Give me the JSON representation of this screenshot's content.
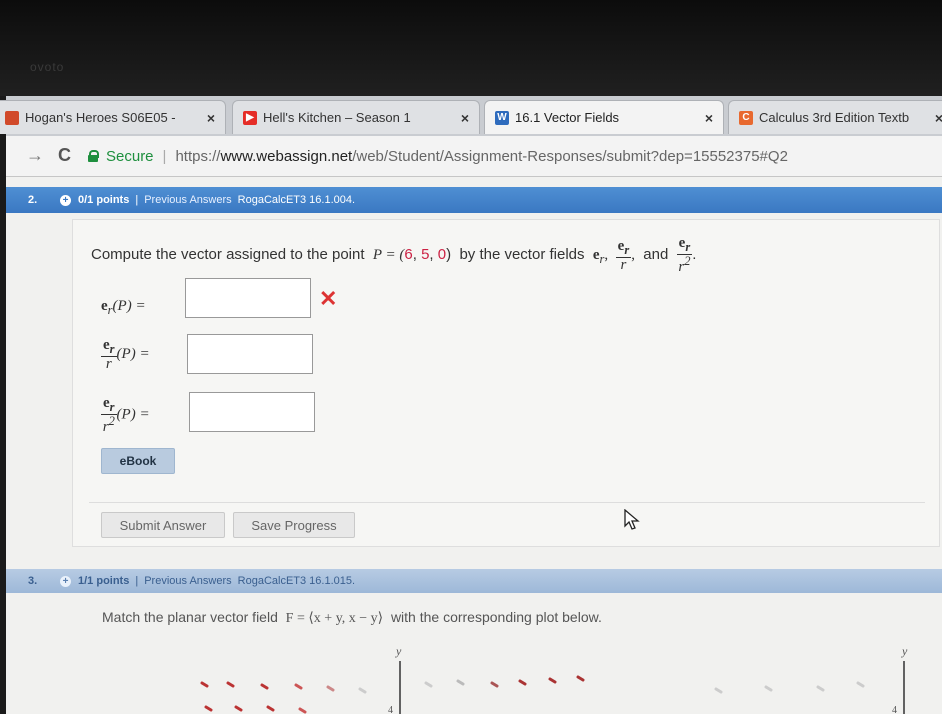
{
  "bezel": {
    "brand": "ovoto"
  },
  "tabs": [
    {
      "title": "Hogan's Heroes S06E05 -",
      "favicon_color": "#d14a2a",
      "favicon_glyph": ""
    },
    {
      "title": "Hell's Kitchen – Season 1",
      "favicon_color": "#e52d27",
      "favicon_glyph": "▶"
    },
    {
      "title": "16.1 Vector Fields",
      "favicon_color": "#2e6bbd",
      "favicon_glyph": "W",
      "active": true
    },
    {
      "title": "Calculus 3rd Edition Textb",
      "favicon_color": "#e8692f",
      "favicon_glyph": "C"
    }
  ],
  "tab_close": "×",
  "address": {
    "back_icon": "→",
    "reload_icon": "C",
    "secure_label": "Secure",
    "scheme": "https://",
    "host": "www.webassign.net",
    "path": "/web/Student/Assignment-Responses/submit?dep=15552375#Q2"
  },
  "question2": {
    "number": "2.",
    "points": "0/1 points",
    "separator": "|",
    "previous_answers": "Previous Answers",
    "code": "RogaCalcET3 16.1.004.",
    "prompt_before": "Compute the vector assigned to the point",
    "point_label": "P = (",
    "point_values": [
      "6",
      "5",
      "0"
    ],
    "point_close": ")",
    "prompt_after": "by the vector fields",
    "field_er": "e",
    "field_sub": "r",
    "and_label": "and",
    "row1_label": "(P) =",
    "row2_label": "(P) =",
    "row3_label": "(P) =",
    "frac_den1": "r",
    "frac_den2": "r",
    "frac_exp": "2",
    "wrong_icon": "✕",
    "ebook_label": "eBook",
    "submit_label": "Submit Answer",
    "save_label": "Save Progress"
  },
  "question3": {
    "number": "3.",
    "points": "1/1 points",
    "separator": "|",
    "previous_answers": "Previous Answers",
    "code": "RogaCalcET3 16.1.015.",
    "prompt": "Match the planar vector field",
    "field": "F = ⟨x + y, x − y⟩",
    "prompt_after": "with the corresponding plot below.",
    "axis_label_y": "y",
    "tick_label": "4"
  }
}
